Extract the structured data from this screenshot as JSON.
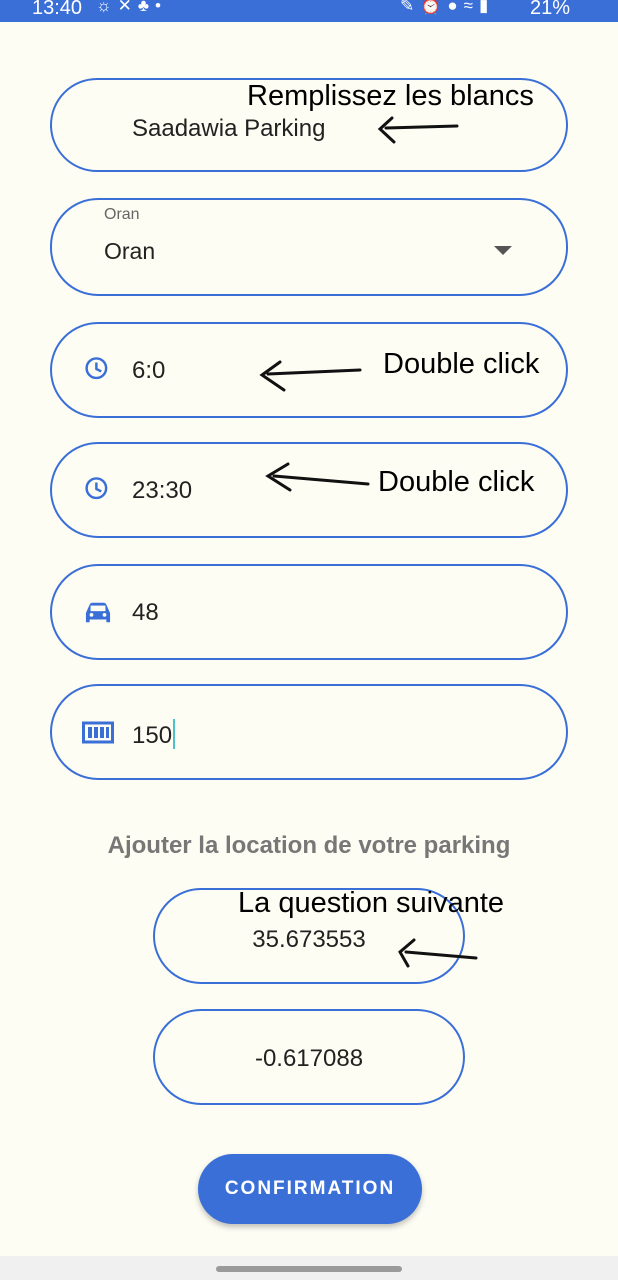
{
  "status_bar": {
    "time": "13:40",
    "battery": "21%"
  },
  "form": {
    "name_field": {
      "value": "Saadawia Parking"
    },
    "city_field": {
      "label": "Oran",
      "value": "Oran"
    },
    "open_time_field": {
      "value": "6:0",
      "icon": "clock-icon"
    },
    "close_time_field": {
      "value": "23:30",
      "icon": "clock-icon"
    },
    "capacity_field": {
      "value": "48",
      "icon": "car-icon"
    },
    "price_field": {
      "value": "150",
      "icon": "meter-icon"
    }
  },
  "location": {
    "title": "Ajouter la location de votre parking",
    "latitude": "35.673553",
    "longitude": "-0.617088"
  },
  "confirm_button": {
    "label": "CONFIRMATION"
  },
  "annotations": {
    "fill_blanks": "Remplissez les blancs",
    "double_click_1": "Double click",
    "double_click_2": "Double click",
    "next_question": "La question suivante"
  },
  "colors": {
    "accent": "#3a6fd8",
    "background": "#fdfdf3",
    "section_title": "#777777"
  }
}
